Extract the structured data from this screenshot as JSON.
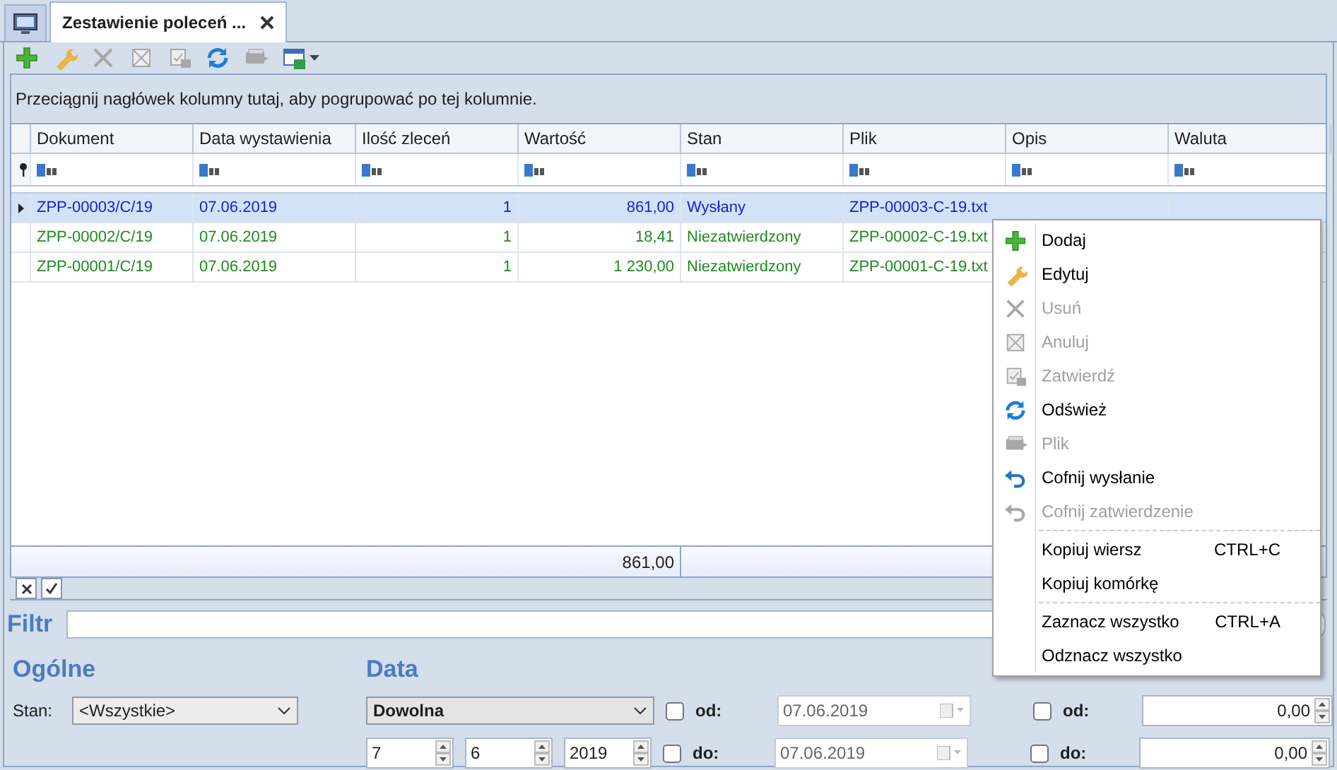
{
  "tab": {
    "title": "Zestawienie poleceń ...",
    "selected": true
  },
  "toolbar": [
    {
      "kind": "add",
      "disabled": false
    },
    {
      "kind": "edit",
      "disabled": false
    },
    {
      "kind": "delete",
      "disabled": true
    },
    {
      "kind": "cancel",
      "disabled": true
    },
    {
      "kind": "approve",
      "disabled": true
    },
    {
      "kind": "refresh",
      "disabled": false
    },
    {
      "kind": "file",
      "disabled": true
    },
    {
      "kind": "export",
      "disabled": false
    }
  ],
  "group_panel_hint": "Przeciągnij nagłówek kolumny tutaj, aby pogrupować po tej kolumnie.",
  "table": {
    "columns": [
      {
        "label": "Dokument"
      },
      {
        "label": "Data wystawienia"
      },
      {
        "label": "Ilość zleceń"
      },
      {
        "label": "Wartość"
      },
      {
        "label": "Stan"
      },
      {
        "label": "Plik"
      },
      {
        "label": "Opis"
      },
      {
        "label": "Waluta"
      }
    ],
    "rows": [
      {
        "selected": true,
        "color": "#1a1ad8",
        "cells": [
          "ZPP-00003/C/19",
          "07.06.2019",
          "1",
          "861,00",
          "Wysłany",
          "ZPP-00003-C-19.txt",
          ""
        ]
      },
      {
        "selected": false,
        "color": "#1e8a1e",
        "cells": [
          "ZPP-00002/C/19",
          "07.06.2019",
          "1",
          "18,41",
          "Niezatwierdzony",
          "ZPP-00002-C-19.txt",
          ""
        ]
      },
      {
        "selected": false,
        "color": "#1e8a1e",
        "cells": [
          "ZPP-00001/C/19",
          "07.06.2019",
          "1",
          "1 230,00",
          "Niezatwierdzony",
          "ZPP-00001-C-19.txt",
          ""
        ]
      }
    ],
    "footer_total": "861,00"
  },
  "filter_enabled": true,
  "filter": {
    "label": "Filtr"
  },
  "general": {
    "title": "Ogólne",
    "state_label": "Stan:",
    "state_value": "<Wszystkie>"
  },
  "date": {
    "title": "Data",
    "range": "Dowolna",
    "day": "7",
    "month": "6",
    "year": "2019",
    "from": {
      "label": "od:",
      "checked": false,
      "value": "07.06.2019",
      "disabled": true
    },
    "to": {
      "label": "do:",
      "checked": false,
      "value": "07.06.2019",
      "disabled": true
    }
  },
  "amount": {
    "from": {
      "label": "od:",
      "checked": false,
      "value": "0,00"
    },
    "to": {
      "label": "do:",
      "checked": false,
      "value": "0,00"
    }
  },
  "context_menu": {
    "items": [
      {
        "kind": "item",
        "label": "Dodaj",
        "disabled": false
      },
      {
        "kind": "item",
        "label": "Edytuj",
        "disabled": false
      },
      {
        "kind": "item",
        "label": "Usuń",
        "disabled": true
      },
      {
        "kind": "item",
        "label": "Anuluj",
        "disabled": true
      },
      {
        "kind": "item",
        "label": "Zatwierdź",
        "disabled": true
      },
      {
        "kind": "item",
        "label": "Odśwież",
        "disabled": false
      },
      {
        "kind": "item",
        "label": "Plik",
        "disabled": true
      },
      {
        "kind": "item",
        "label": "Cofnij wysłanie",
        "disabled": false
      },
      {
        "kind": "item",
        "label": "Cofnij zatwierdzenie",
        "disabled": true
      },
      {
        "kind": "separator"
      },
      {
        "kind": "item",
        "label": "Kopiuj wiersz",
        "shortcut": "CTRL+C",
        "disabled": false
      },
      {
        "kind": "item",
        "label": "Kopiuj komórkę",
        "disabled": false
      },
      {
        "kind": "separator"
      },
      {
        "kind": "item",
        "label": "Zaznacz wszystko",
        "shortcut": "CTRL+A",
        "disabled": false
      },
      {
        "kind": "item",
        "label": "Odznacz wszystko",
        "disabled": false
      }
    ]
  }
}
